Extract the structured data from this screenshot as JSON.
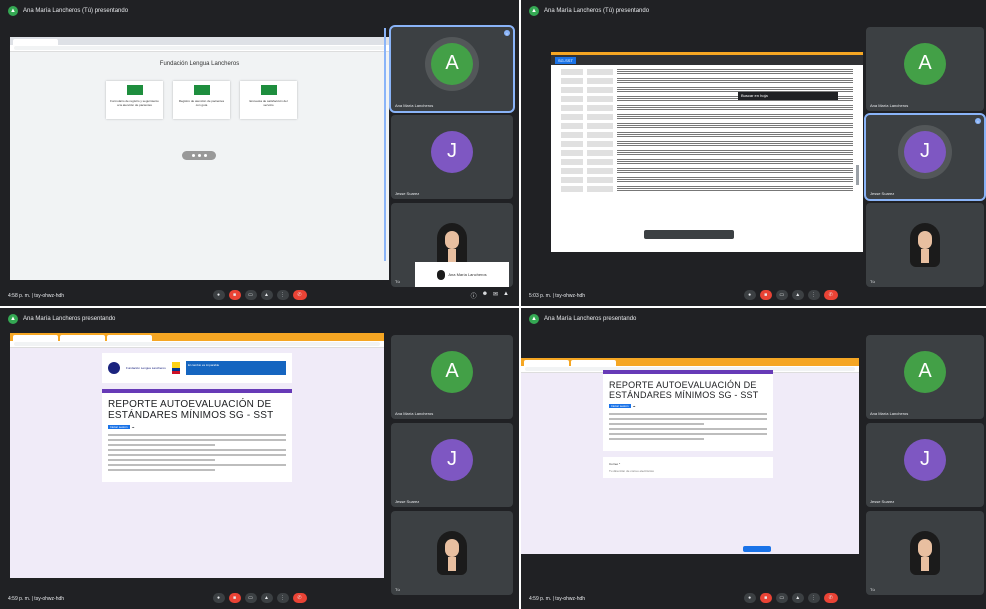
{
  "quadrants": {
    "q1": {
      "presenting_label": "Ana María Lancheros (Tú) presentando",
      "clock": "4:58 p. m. | tsy-ohwz-hdh",
      "form_title": "Fundación Lengua Lancheros",
      "cards": [
        {
          "text": "Formulario de registro y seguimiento a la atención de pacientes"
        },
        {
          "text": "Registro de atención de pacientes con guía"
        },
        {
          "text": "Encuesta de satisfacción del servicio"
        }
      ],
      "self_view_label": "Ana María Lancheros"
    },
    "q2": {
      "presenting_label": "Ana María Lancheros (Tú) presentando",
      "clock": "5:03 p. m. | tsy-ohwz-hdh",
      "sheet_chip": "SG-SST",
      "find_label": "Buscar en hoja"
    },
    "q3": {
      "presenting_label": "Ana María Lancheros presentando",
      "clock": "4:59 p. m. | tsy-ohwz-hdh",
      "banner_org": "Fundación Lengua Lancheros",
      "banner_gov": "El cambio es imparable",
      "doc_title": "REPORTE AUTOEVALUACIÓN DE ESTÁNDARES MÍNIMOS SG - SST",
      "chip": "Iniciar sesión"
    },
    "q4": {
      "presenting_label": "Ana María Lancheros presentando",
      "clock": "4:59 p. m. | tsy-ohwz-hdh",
      "doc_title": "REPORTE AUTOEVALUACIÓN DE ESTÁNDARES MÍNIMOS SG - SST",
      "chip": "Iniciar sesión",
      "card2_label": "Correo *",
      "card2_value": "Tu dirección de correo electrónico"
    }
  },
  "participants": [
    {
      "initial": "A",
      "name": "Ana María Lancheros",
      "color": "#43a047"
    },
    {
      "initial": "J",
      "name": "Jesse Suarez",
      "color": "#7e57c2"
    },
    {
      "name": "Tú"
    }
  ],
  "colors": {
    "meet_bg": "#202124",
    "tile_bg": "#3c4043",
    "end_call": "#ea4335",
    "form_accent": "#673ab7"
  }
}
